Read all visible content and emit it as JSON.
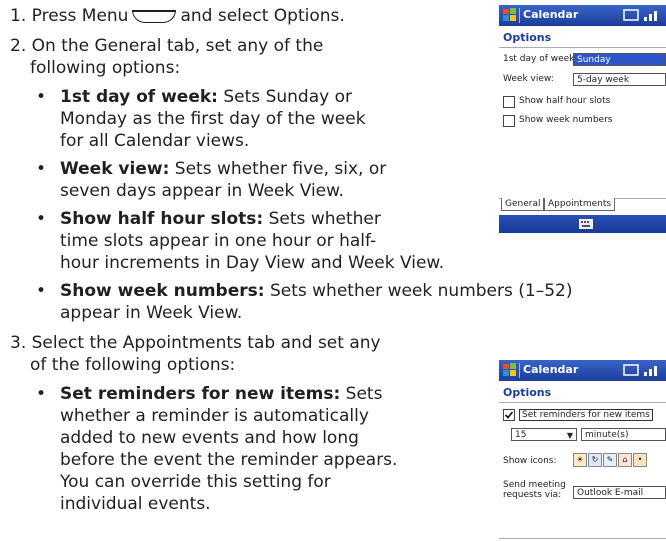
{
  "steps": {
    "s1": {
      "num": "1.",
      "before": "Press Menu",
      "after": "and select Options."
    },
    "s2": {
      "num": "2.",
      "line1": "On the General tab, set any of the",
      "line2": "following options:"
    },
    "b1": {
      "term": "1st day of week:",
      "l1": " Sets Sunday or",
      "l2": "Monday as the first day of the week",
      "l3": "for all Calendar views."
    },
    "b2": {
      "term": "Week view:",
      "l1": " Sets whether five, six, or",
      "l2": "seven days appear in Week View."
    },
    "b3": {
      "term": "Show half hour slots:",
      "l1": " Sets whether",
      "l2": "time slots appear in one hour or half-",
      "l3": "hour increments in Day View and Week View."
    },
    "b4": {
      "term": "Show week numbers:",
      "l1": " Sets whether week numbers (1–52)",
      "l2": "appear in Week View."
    },
    "s3": {
      "num": "3.",
      "line1": "Select the Appointments tab and set any",
      "line2": "of the following options:"
    },
    "b5": {
      "term": "Set reminders for new items:",
      "l1": " Sets",
      "l2": "whether a reminder is automatically",
      "l3": "added to new events and how long",
      "l4": "before the event the reminder appears.",
      "l5": "You can override this setting for",
      "l6": "individual events."
    }
  },
  "bullet": "•",
  "screen1": {
    "app": "Calendar",
    "heading": "Options",
    "row1_label": "1st day of week:",
    "row1_value": "Sunday",
    "row2_label": "Week view:",
    "row2_value": "5-day week",
    "cb1": "Show half hour slots",
    "cb2": "Show week numbers",
    "tab1": "General",
    "tab2": "Appointments"
  },
  "screen2": {
    "app": "Calendar",
    "heading": "Options",
    "cb": "Set reminders for new items",
    "num": "15",
    "unit": "minute(s)",
    "icons_label": "Show icons:",
    "send_l1": "Send meeting",
    "send_l2": "requests via:",
    "send_value": "Outlook E-mail"
  },
  "icons": {
    "menu": "menu-key-icon",
    "flag": "windows-flag-icon",
    "signal": "signal-icon",
    "keyboard": "keyboard-icon"
  }
}
